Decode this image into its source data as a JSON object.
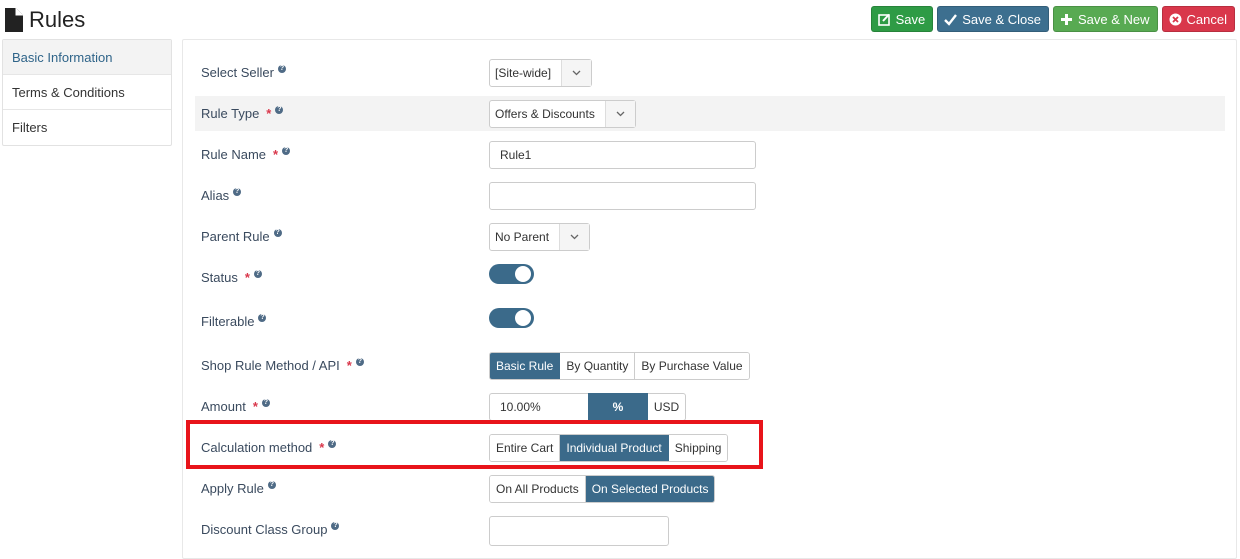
{
  "header": {
    "title": "Rules",
    "icon": "document-icon"
  },
  "toolbar": {
    "save_label": "Save",
    "save_close_label": "Save & Close",
    "save_new_label": "Save & New",
    "cancel_label": "Cancel",
    "colors": {
      "save": "#2e9b45",
      "save_close": "#3d6f8f",
      "save_new": "#58aa52",
      "cancel": "#d9374b"
    }
  },
  "sidebar": {
    "items": [
      {
        "label": "Basic Information",
        "active": true
      },
      {
        "label": "Terms & Conditions",
        "active": false
      },
      {
        "label": "Filters",
        "active": false
      }
    ]
  },
  "form": {
    "select_seller": {
      "label": "Select Seller",
      "value": "[Site-wide]"
    },
    "rule_type": {
      "label": "Rule Type",
      "value": "Offers & Discounts"
    },
    "rule_name": {
      "label": "Rule Name",
      "value": "Rule1"
    },
    "alias": {
      "label": "Alias",
      "value": ""
    },
    "parent_rule": {
      "label": "Parent Rule",
      "value": "No Parent"
    },
    "status": {
      "label": "Status",
      "on": true
    },
    "filterable": {
      "label": "Filterable",
      "on": true
    },
    "method": {
      "label": "Shop Rule Method / API",
      "options": [
        "Basic Rule",
        "By Quantity",
        "By Purchase Value"
      ],
      "selected": "Basic Rule"
    },
    "amount": {
      "label": "Amount",
      "value": "10.00%",
      "percent": "%",
      "currency": "USD"
    },
    "calculation": {
      "label": "Calculation method",
      "options": [
        "Entire Cart",
        "Individual Product",
        "Shipping"
      ],
      "selected": "Individual Product"
    },
    "apply_rule": {
      "label": "Apply Rule",
      "options": [
        "On All Products",
        "On Selected Products"
      ],
      "selected": "On Selected Products"
    },
    "discount_class_group": {
      "label": "Discount Class Group",
      "value": ""
    }
  },
  "accent_color": "#3b6a8a",
  "required_color": "#d9374b",
  "highlight_color": "#e8141a"
}
